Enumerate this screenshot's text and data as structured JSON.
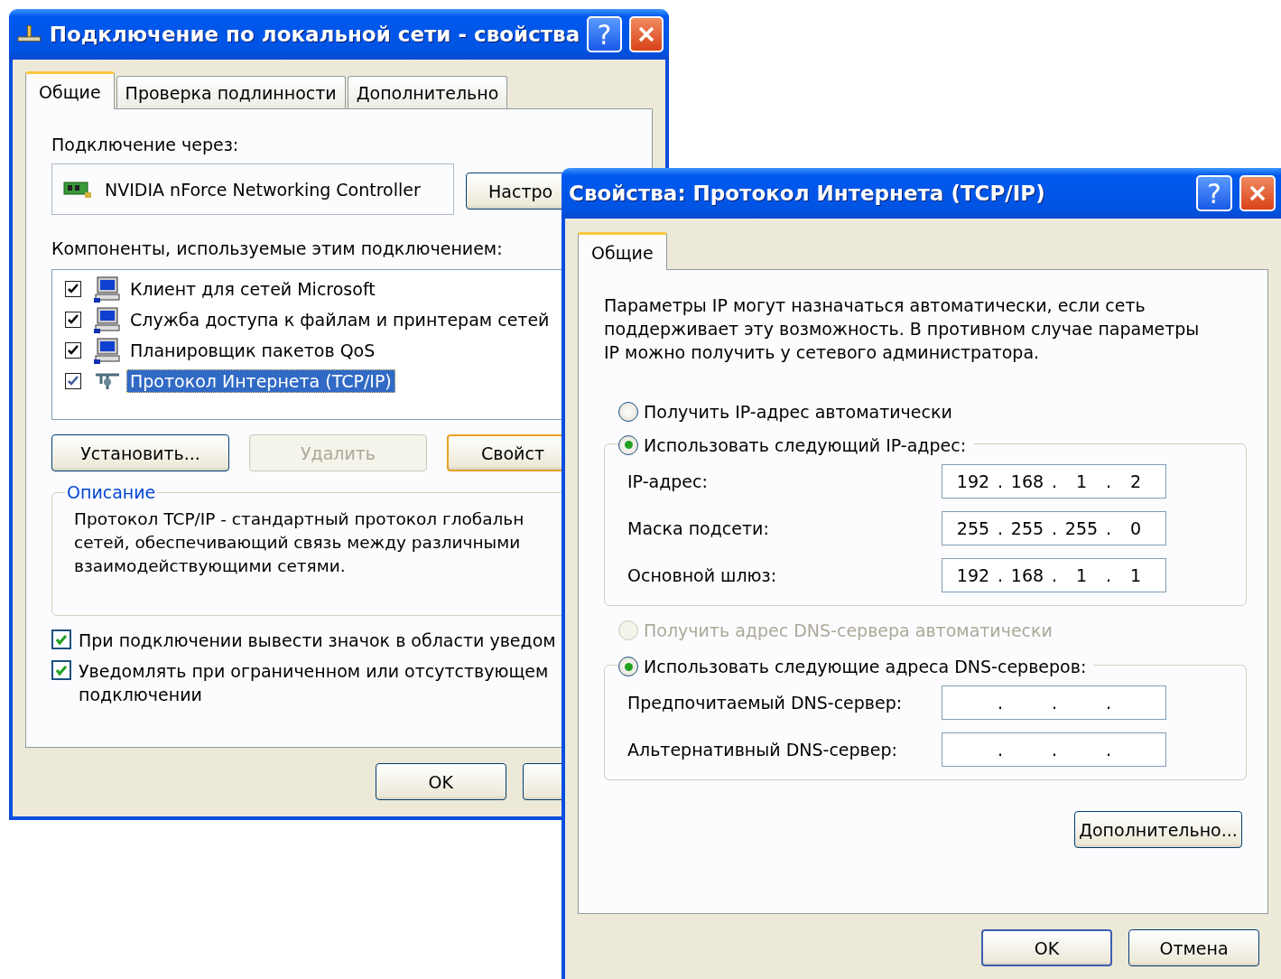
{
  "windows": [
    {
      "title": "Подключение по локальной сети - свойства",
      "help": "?",
      "tabs": [
        {
          "label": "Общие",
          "selected": true
        },
        {
          "label": "Проверка подлинности",
          "selected": false
        },
        {
          "label": "Дополнительно",
          "selected": false
        }
      ],
      "connect_label": "Подключение через:",
      "adapter": "NVIDIA nForce Networking Controller",
      "configure_button": "Настро",
      "components_label": "Компоненты, используемые этим подключением:",
      "components": [
        {
          "name": "Клиент для сетей Microsoft",
          "kind": "computer",
          "checked": true,
          "selected": false
        },
        {
          "name": "Служба доступа к файлам и принтерам сетей",
          "kind": "computer",
          "checked": true,
          "selected": false
        },
        {
          "name": "Планировщик пакетов QoS",
          "kind": "computer",
          "checked": true,
          "selected": false
        },
        {
          "name": "Протокол Интернета (TCP/IP)",
          "kind": "protocol",
          "checked": true,
          "selected": true
        }
      ],
      "buttons": [
        {
          "label": "Установить...",
          "disabled": false,
          "default": false
        },
        {
          "label": "Удалить",
          "disabled": true,
          "default": false
        },
        {
          "label": "Свойст",
          "disabled": false,
          "default": true
        }
      ],
      "description": {
        "title": "Описание",
        "lines": [
          "Протокол TCP/IP - стандартный протокол глобальн",
          "сетей, обеспечивающий связь между различными",
          "взаимодействующими сетями."
        ]
      },
      "options": [
        {
          "label": "При подключении вывести значок в области уведом",
          "checked": true
        },
        {
          "label": "Уведомлять при ограниченном или отсутствующем подключении",
          "checked": true
        }
      ],
      "ok_button": "OK"
    },
    {
      "title": "Свойства: Протокол Интернета (TCP/IP)",
      "help": "?",
      "tabs": [
        {
          "label": "Общие",
          "selected": true
        }
      ],
      "intro_lines": [
        "Параметры IP могут назначаться автоматически, если сеть",
        "поддерживает эту возможность. В противном случае параметры",
        "IP можно получить у сетевого администратора."
      ],
      "ip_auto": {
        "label": "Получить IP-адрес автоматически",
        "selected": false,
        "disabled": false
      },
      "ip_manual": {
        "label": "Использовать следующий IP-адрес:",
        "selected": true,
        "disabled": false
      },
      "ip_fields": [
        {
          "label": "IP-адрес:",
          "octets": [
            "192",
            "168",
            "1",
            "2"
          ],
          "dots": [
            ".",
            ".",
            "."
          ]
        },
        {
          "label": "Маска подсети:",
          "octets": [
            "255",
            "255",
            "255",
            "0"
          ],
          "dots": [
            ".",
            ".",
            "."
          ]
        },
        {
          "label": "Основной шлюз:",
          "octets": [
            "192",
            "168",
            "1",
            "1"
          ],
          "dots": [
            ".",
            ".",
            "."
          ]
        }
      ],
      "dns_auto": {
        "label": "Получить адрес DNS-сервера автоматически",
        "selected": false,
        "disabled": true
      },
      "dns_manual": {
        "label": "Использовать следующие адреса DNS-серверов:",
        "selected": true,
        "disabled": false
      },
      "dns_fields": [
        {
          "label": "Предпочитаемый DNS-сервер:",
          "dots": [
            ".",
            ".",
            "."
          ]
        },
        {
          "label": "Альтернативный DNS-сервер:",
          "dots": [
            ".",
            ".",
            "."
          ]
        }
      ],
      "advanced_button": "Дополнительно...",
      "ok_button": "OK",
      "cancel_button": "Отмена"
    }
  ]
}
